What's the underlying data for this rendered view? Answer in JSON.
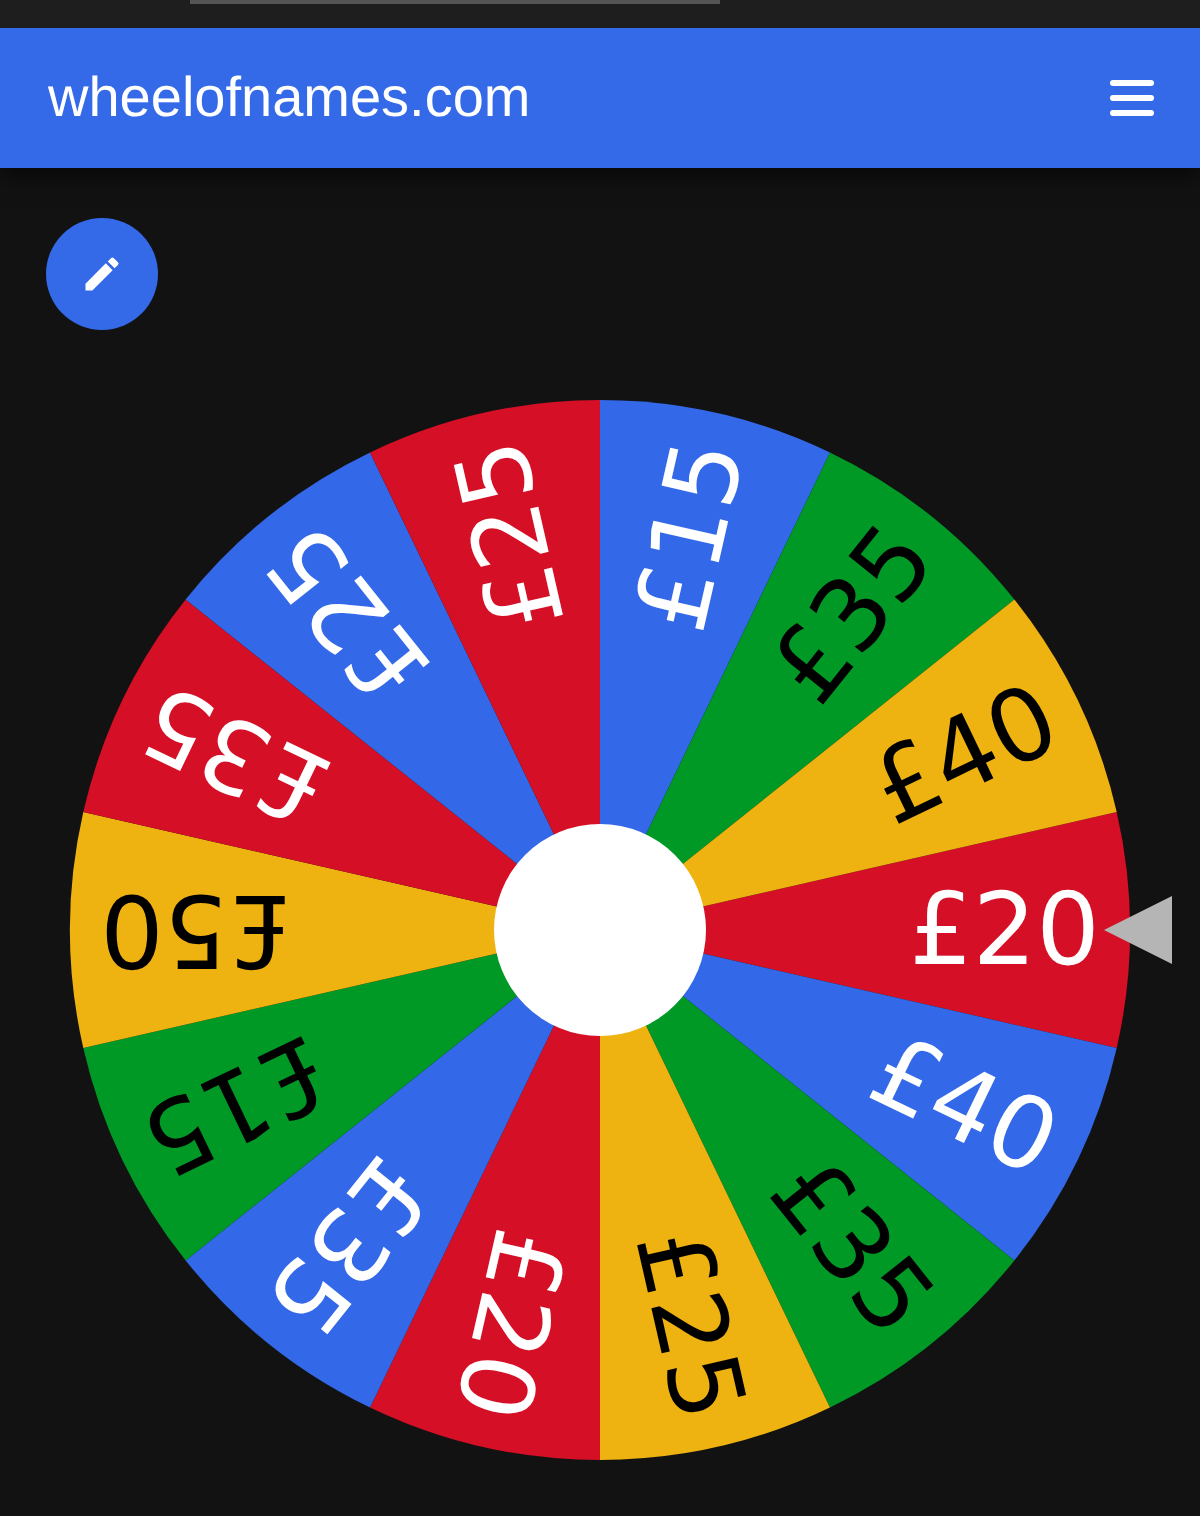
{
  "header": {
    "title": "wheelofnames.com"
  },
  "wheel": {
    "segments": [
      {
        "label": "£20",
        "color": "#d50f25"
      },
      {
        "label": "£40",
        "color": "#3369e8"
      },
      {
        "label": "£35",
        "color": "#009925"
      },
      {
        "label": "£25",
        "color": "#eeb211"
      },
      {
        "label": "£20",
        "color": "#d50f25"
      },
      {
        "label": "£35",
        "color": "#3369e8"
      },
      {
        "label": "£15",
        "color": "#009925"
      },
      {
        "label": "£50",
        "color": "#eeb211"
      },
      {
        "label": "£35",
        "color": "#d50f25"
      },
      {
        "label": "£25",
        "color": "#3369e8"
      },
      {
        "label": "£25",
        "color": "#d50f25"
      },
      {
        "label": "£15",
        "color": "#3369e8"
      },
      {
        "label": "£35",
        "color": "#009925"
      },
      {
        "label": "£40",
        "color": "#eeb211"
      }
    ]
  }
}
